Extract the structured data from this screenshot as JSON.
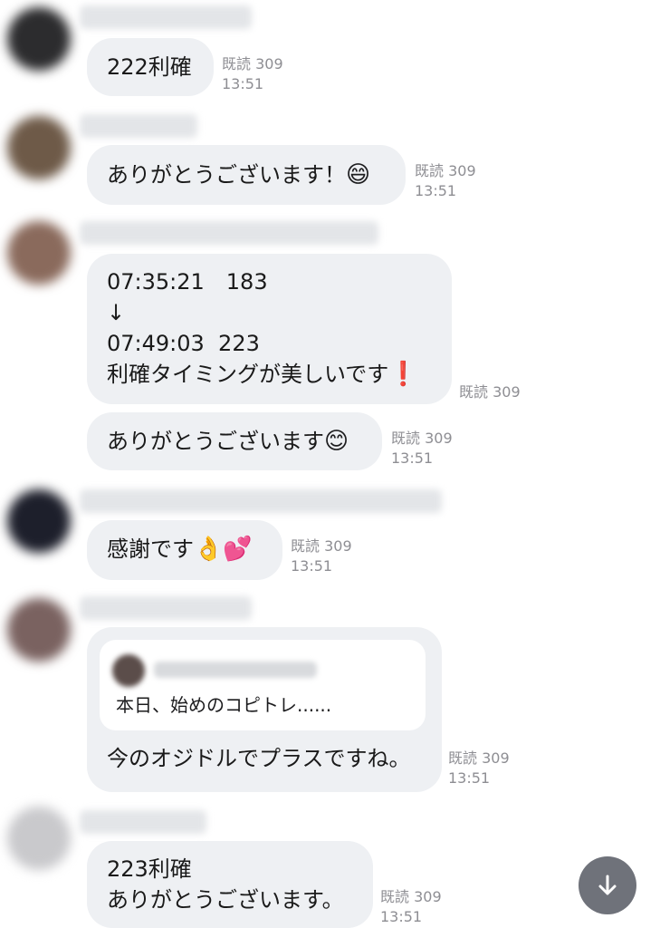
{
  "messages": [
    {
      "text": "222利確",
      "read": "既読 309",
      "time": "13:51"
    },
    {
      "text": "ありがとうございます！",
      "emoji": "😄",
      "read": "既読 309",
      "time": "13:51"
    },
    {
      "line1": "07:35:21　183",
      "line2": "↓",
      "line3": "07:49:03  223",
      "line4": "利確タイミングが美しいです",
      "emoji": "❗",
      "read": "既読 309"
    },
    {
      "text": "ありがとうございます",
      "emoji": "😊",
      "read": "既読 309",
      "time": "13:51"
    },
    {
      "text": "感謝です",
      "emoji": "👌💕",
      "read": "既読 309",
      "time": "13:51"
    },
    {
      "quote": "本日、始めのコピトレ......",
      "text": "今のオジドルでプラスですね。",
      "read": "既読 309",
      "time": "13:51"
    },
    {
      "line1": "223利確",
      "line2": "ありがとうございます。",
      "read": "既読 309",
      "time": "13:51"
    }
  ],
  "colors": {
    "bubble": "#eef0f3",
    "meta": "#8e8e93",
    "fab": "#6f727a"
  },
  "icons": {
    "scroll_down": "arrow-down-icon"
  }
}
